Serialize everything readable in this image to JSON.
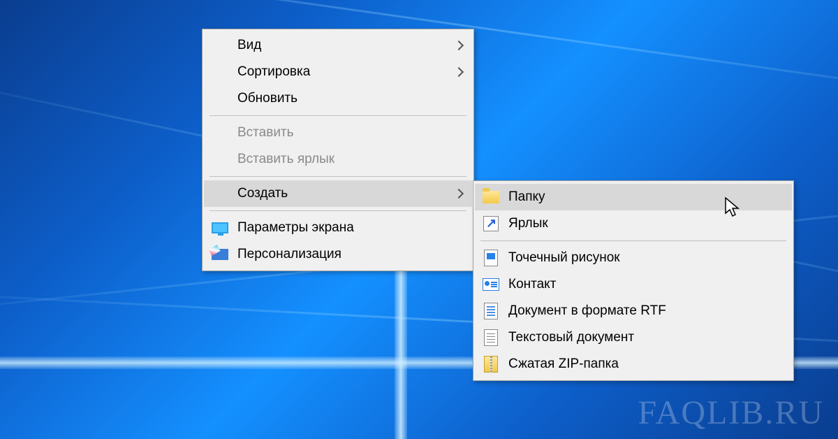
{
  "watermark": "FAQLIB.RU",
  "main_menu": {
    "view": "Вид",
    "sort": "Сортировка",
    "refresh": "Обновить",
    "paste": "Вставить",
    "paste_shortcut": "Вставить ярлык",
    "create": "Создать",
    "display_settings": "Параметры экрана",
    "personalize": "Персонализация"
  },
  "sub_menu": {
    "folder": "Папку",
    "shortcut": "Ярлык",
    "bitmap": "Точечный рисунок",
    "contact": "Контакт",
    "rtf": "Документ в формате RTF",
    "txt": "Текстовый документ",
    "zip": "Сжатая ZIP-папка"
  }
}
